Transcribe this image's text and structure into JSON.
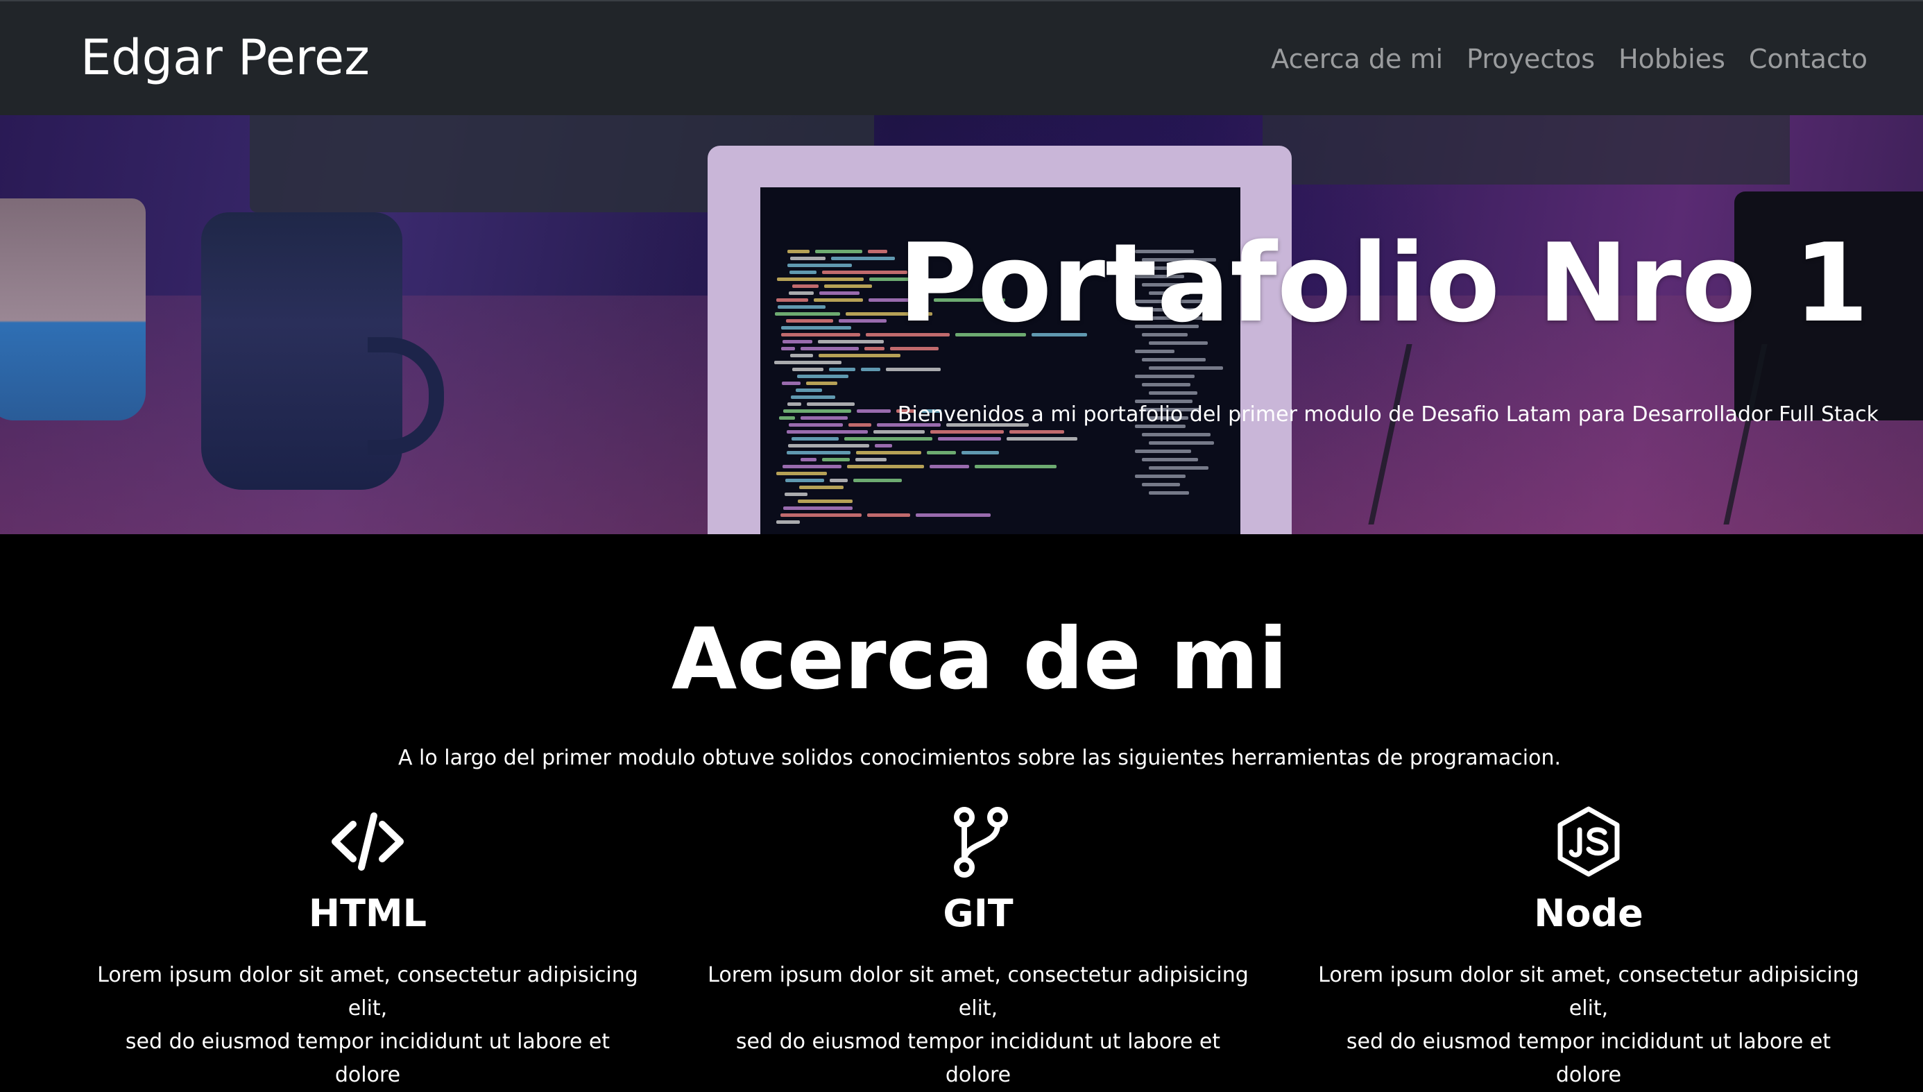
{
  "navbar": {
    "brand": "Edgar Perez",
    "links": [
      {
        "label": "Acerca de mi"
      },
      {
        "label": "Proyectos"
      },
      {
        "label": "Hobbies"
      },
      {
        "label": "Contacto"
      }
    ]
  },
  "hero": {
    "title": "Portafolio Nro 1",
    "subtitle": "Bienvenidos a mi portafolio del primer modulo de Desafio Latam para Desarrollador Full Stack"
  },
  "about": {
    "title": "Acerca de mi",
    "text": "A lo largo del primer modulo obtuve solidos conocimientos sobre las siguientes herramientas de programacion.",
    "skills": [
      {
        "icon": "code-icon",
        "name": "HTML",
        "desc_line1": "Lorem ipsum dolor sit amet, consectetur adipisicing elit,",
        "desc_line2": "sed do eiusmod tempor incididunt ut labore et dolore"
      },
      {
        "icon": "git-branch-icon",
        "name": "GIT",
        "desc_line1": "Lorem ipsum dolor sit amet, consectetur adipisicing elit,",
        "desc_line2": "sed do eiusmod tempor incididunt ut labore et dolore"
      },
      {
        "icon": "nodejs-icon",
        "name": "Node",
        "desc_line1": "Lorem ipsum dolor sit amet, consectetur adipisicing elit,",
        "desc_line2": "sed do eiusmod tempor incididunt ut labore et dolore"
      }
    ]
  },
  "colors": {
    "navbar_bg": "#212529",
    "nav_link": "rgba(255,255,255,0.55)",
    "page_bg": "#000000",
    "text": "#ffffff"
  }
}
